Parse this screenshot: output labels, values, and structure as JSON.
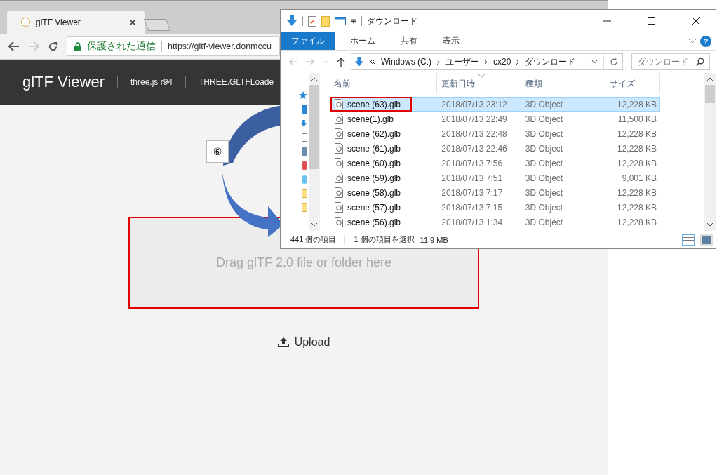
{
  "browser": {
    "tab": {
      "title": "glTF Viewer",
      "selected": true
    },
    "security_label": "保護された通信",
    "url": "https://gltf-viewer.donmccu"
  },
  "app_header": {
    "title": "glTF Viewer",
    "links": [
      "three.js r94",
      "THREE.GLTFLoade"
    ]
  },
  "drop_zone": {
    "text": "Drag glTF 2.0 file or folder here",
    "outlined": true
  },
  "upload_button": {
    "label": "Upload"
  },
  "annotation": {
    "step_label": "⑥"
  },
  "explorer": {
    "title": "ダウンロード",
    "ribbon_tabs": [
      {
        "label": "ファイル",
        "selected": true
      },
      {
        "label": "ホーム",
        "selected": false
      },
      {
        "label": "共有",
        "selected": false
      },
      {
        "label": "表示",
        "selected": false
      }
    ],
    "breadcrumb": [
      "Windows (C:)",
      "ユーザー",
      "cx20",
      "ダウンロード"
    ],
    "search": {
      "placeholder": "ダウンロード"
    },
    "help_label": "?",
    "columns": [
      "名前",
      "更新日時",
      "種類",
      "サイズ"
    ],
    "rows": [
      {
        "name": "scene (63).glb",
        "date": "2018/07/13 23:12",
        "type": "3D Object",
        "size": "12,228 KB",
        "selected": true,
        "outlined": true
      },
      {
        "name": "scene(1).glb",
        "date": "2018/07/13 22:49",
        "type": "3D Object",
        "size": "11,500 KB",
        "selected": false,
        "outlined": false
      },
      {
        "name": "scene (62).glb",
        "date": "2018/07/13 22:48",
        "type": "3D Object",
        "size": "12,228 KB",
        "selected": false,
        "outlined": false
      },
      {
        "name": "scene (61).glb",
        "date": "2018/07/13 22:46",
        "type": "3D Object",
        "size": "12,228 KB",
        "selected": false,
        "outlined": false
      },
      {
        "name": "scene (60).glb",
        "date": "2018/07/13 7:56",
        "type": "3D Object",
        "size": "12,228 KB",
        "selected": false,
        "outlined": false
      },
      {
        "name": "scene (59).glb",
        "date": "2018/07/13 7:51",
        "type": "3D Object",
        "size": "9,001 KB",
        "selected": false,
        "outlined": false
      },
      {
        "name": "scene (58).glb",
        "date": "2018/07/13 7:17",
        "type": "3D Object",
        "size": "12,228 KB",
        "selected": false,
        "outlined": false
      },
      {
        "name": "scene (57).glb",
        "date": "2018/07/13 7:15",
        "type": "3D Object",
        "size": "12,228 KB",
        "selected": false,
        "outlined": false
      },
      {
        "name": "scene (56).glb",
        "date": "2018/07/13 1:34",
        "type": "3D Object",
        "size": "12,228 KB",
        "selected": false,
        "outlined": false
      }
    ],
    "status": {
      "item_count": "441 個の項目",
      "selection": "1 個の項目を選択",
      "selection_size": "11.9 MB"
    }
  }
}
